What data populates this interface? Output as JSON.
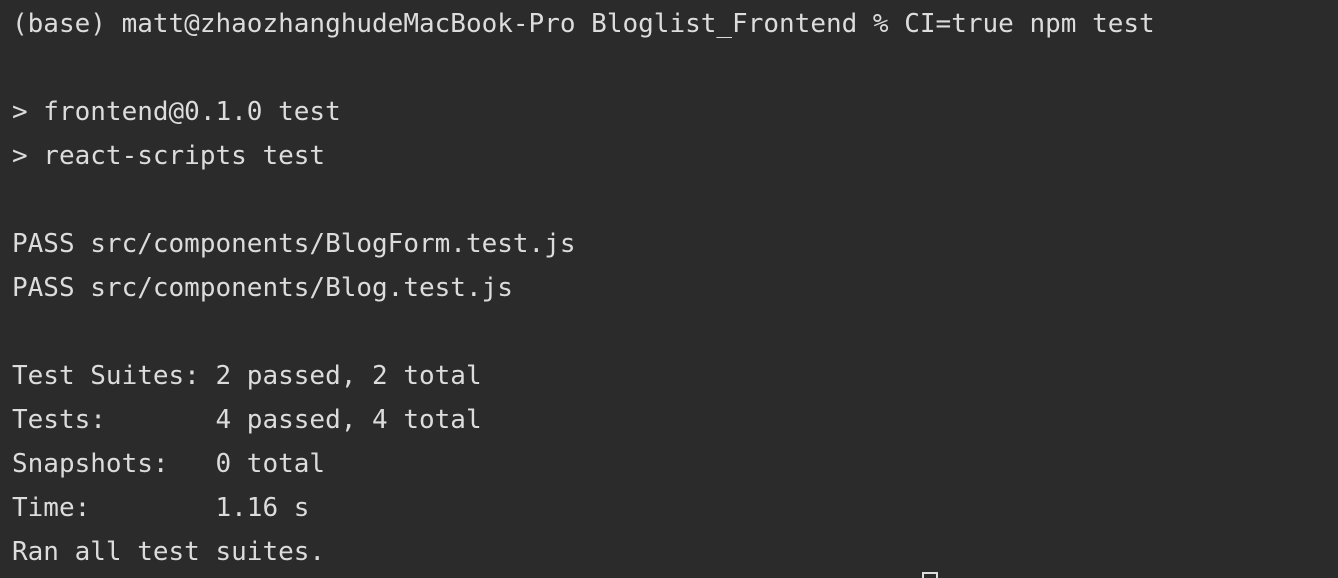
{
  "terminal": {
    "lines": [
      "(base) matt@zhaozhanghudeMacBook-Pro Bloglist_Frontend % CI=true npm test",
      "",
      "> frontend@0.1.0 test",
      "> react-scripts test",
      "",
      "PASS src/components/BlogForm.test.js",
      "PASS src/components/Blog.test.js",
      "",
      "Test Suites: 2 passed, 2 total",
      "Tests:       4 passed, 4 total",
      "Snapshots:   0 total",
      "Time:        1.16 s",
      "Ran all test suites."
    ]
  }
}
